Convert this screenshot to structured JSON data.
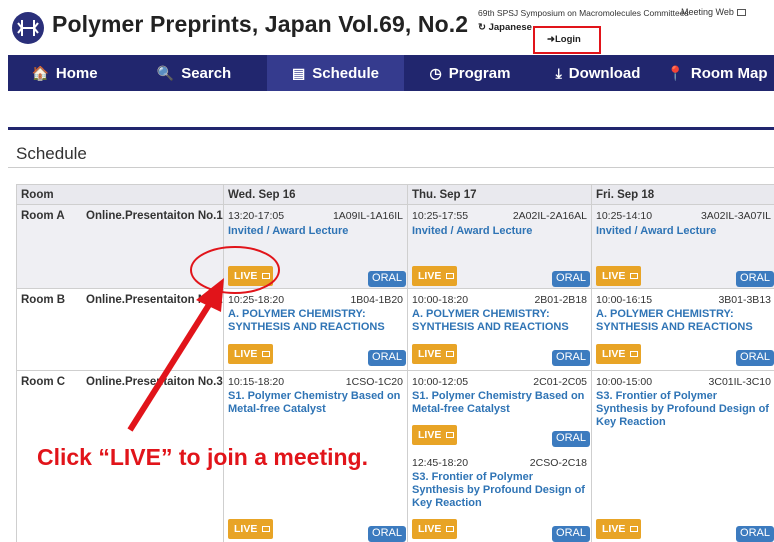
{
  "header": {
    "title": "Polymer Preprints, Japan Vol.69, No.2",
    "symposium": "69th SPSJ Symposium on Macromolecules Committees",
    "meeting_web": "Meeting Web",
    "language": "Japanese",
    "login": "Login"
  },
  "nav": [
    {
      "label": "Home",
      "icon": "home-icon",
      "glyph": "🏠"
    },
    {
      "label": "Search",
      "icon": "search-icon",
      "glyph": "🔍"
    },
    {
      "label": "Schedule",
      "icon": "list-icon",
      "glyph": "▤"
    },
    {
      "label": "Program",
      "icon": "clock-icon",
      "glyph": "◷"
    },
    {
      "label": "Download",
      "icon": "download-icon",
      "glyph": "⤓"
    },
    {
      "label": "Room Map",
      "icon": "map-pin-icon",
      "glyph": "📍"
    }
  ],
  "page": {
    "heading": "Schedule"
  },
  "table": {
    "room_header": "Room",
    "days": [
      "Wed. Sep 16",
      "Thu. Sep 17",
      "Fri. Sep 18"
    ],
    "rows": [
      {
        "room": "Room A",
        "online": "Online.Presentaiton No.1",
        "sessions": [
          {
            "time": "13:20-17:05",
            "code": "1A09IL-1A16IL",
            "title": "Invited / Award Lecture",
            "live": "LIVE",
            "oral": "ORAL"
          },
          {
            "time": "10:25-17:55",
            "code": "2A02IL-2A16AL",
            "title": "Invited / Award Lecture",
            "live": "LIVE",
            "oral": "ORAL"
          },
          {
            "time": "10:25-14:10",
            "code": "3A02IL-3A07IL",
            "title": "Invited / Award Lecture",
            "live": "LIVE",
            "oral": "ORAL"
          }
        ]
      },
      {
        "room": "Room B",
        "online": "Online.Presentaiton No.2",
        "sessions": [
          {
            "time": "10:25-18:20",
            "code": "1B04-1B20",
            "title": "A. POLYMER CHEMISTRY: SYNTHESIS AND REACTIONS",
            "live": "LIVE",
            "oral": "ORAL"
          },
          {
            "time": "10:00-18:20",
            "code": "2B01-2B18",
            "title": "A. POLYMER CHEMISTRY: SYNTHESIS AND REACTIONS",
            "live": "LIVE",
            "oral": "ORAL"
          },
          {
            "time": "10:00-16:15",
            "code": "3B01-3B13",
            "title": "A. POLYMER CHEMISTRY: SYNTHESIS AND REACTIONS",
            "live": "LIVE",
            "oral": "ORAL"
          }
        ]
      },
      {
        "room": "Room C",
        "online": "Online.Presentaiton No.3",
        "sessions": [
          {
            "time": "10:15-18:20",
            "code": "1CSO-1C20",
            "title": "S1. Polymer Chemistry Based on Metal-free Catalyst",
            "live": "LIVE",
            "oral": "ORAL"
          },
          {
            "time": "10:00-12:05",
            "code": "2C01-2C05",
            "title": "S1. Polymer Chemistry Based on Metal-free Catalyst",
            "live": "LIVE",
            "oral": "ORAL",
            "second": {
              "time": "12:45-18:20",
              "code": "2CSO-2C18",
              "title": "S3. Frontier of Polymer Synthesis by Profound Design of Key Reaction",
              "live": "LIVE",
              "oral": "ORAL"
            }
          },
          {
            "time": "10:00-15:00",
            "code": "3C01IL-3C10",
            "title": "S3. Frontier of Polymer Synthesis by Profound Design of Key Reaction",
            "live": "LIVE",
            "oral": "ORAL"
          }
        ]
      }
    ]
  },
  "annotation": {
    "text": "Click “LIVE” to join a meeting.",
    "color": "#e1141a"
  },
  "colors": {
    "nav": "#21266e",
    "nav_active": "#353b8e",
    "live": "#e8a426",
    "oral": "#3c7bbf",
    "link": "#2f74b5"
  }
}
